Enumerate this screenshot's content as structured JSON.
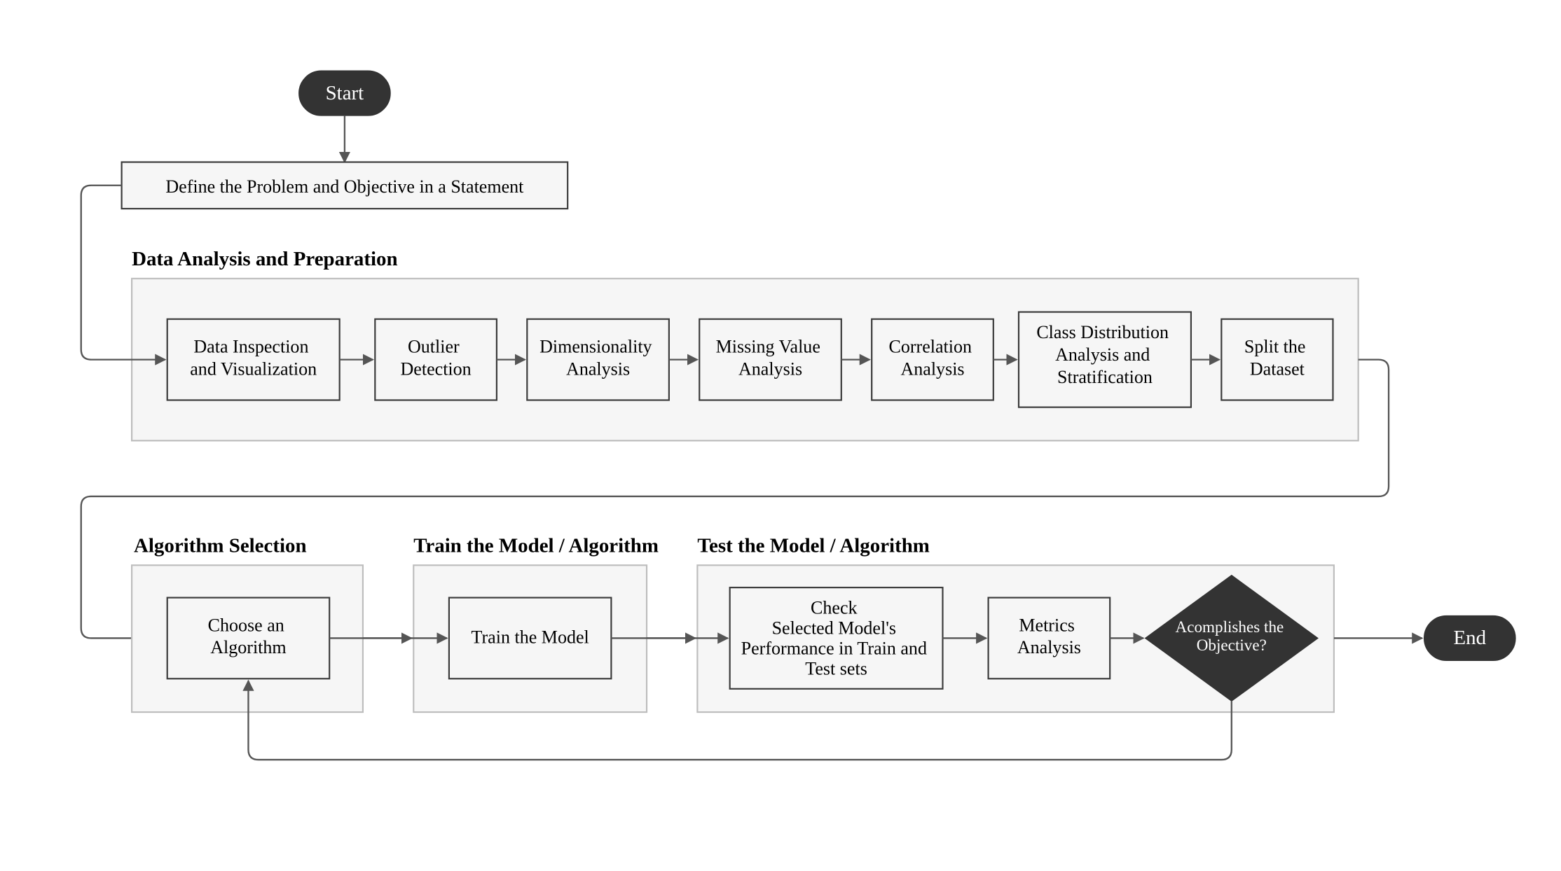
{
  "terminals": {
    "start": "Start",
    "end": "End"
  },
  "defineProblem": "Define the Problem and Objective in a Statement",
  "groups": {
    "dataPrep": {
      "heading": "Data Analysis and Preparation",
      "steps": [
        "Data Inspection and Visualization",
        "Outlier Detection",
        "Dimensionality Analysis",
        "Missing Value Analysis",
        "Correlation Analysis",
        "Class Distribution Analysis and Stratification",
        "Split the Dataset"
      ]
    },
    "algoSelect": {
      "heading": "Algorithm Selection",
      "step": "Choose an Algorithm"
    },
    "trainModel": {
      "heading": "Train the Model / Algorithm",
      "step": "Train the Model"
    },
    "testModel": {
      "heading": "Test the Model / Algorithm",
      "steps": [
        "Check Selected Model's Performance in Train and Test sets",
        "Metrics Analysis"
      ],
      "decision": "Acomplishes the Objective?"
    }
  }
}
